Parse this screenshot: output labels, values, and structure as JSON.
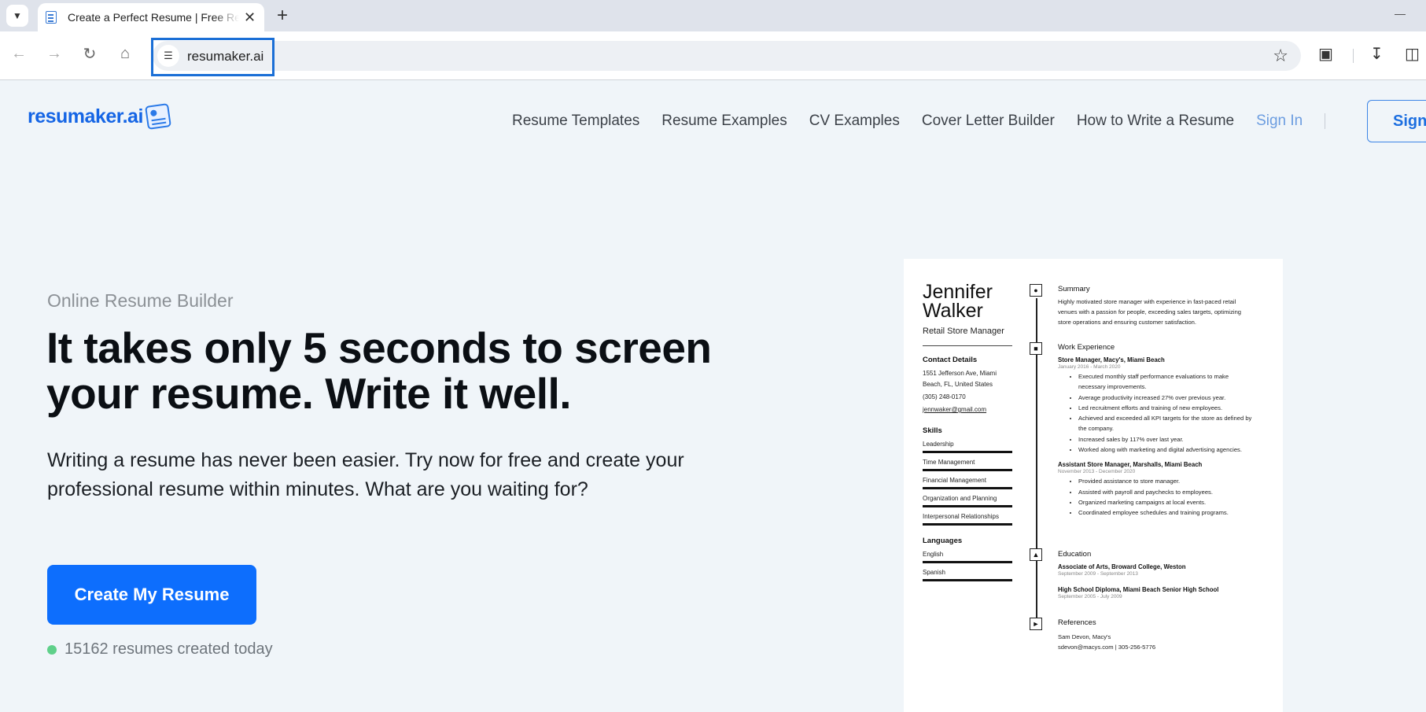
{
  "browser": {
    "tab_title": "Create a Perfect Resume | Free Resume Builder",
    "url": "resumaker.ai"
  },
  "site": {
    "logo": "resumaker.ai",
    "nav": [
      "Resume Templates",
      "Resume Examples",
      "CV Examples",
      "Cover Letter Builder",
      "How to Write a Resume"
    ],
    "sign_in": "Sign In",
    "sign_up": "Sign"
  },
  "hero": {
    "eyebrow": "Online Resume Builder",
    "headline": "It takes only 5 seconds to screen your resume. Write it well.",
    "subtext": "Writing a resume has never been easier. Try now for free and create your professional resume within minutes. What are you waiting for?",
    "cta": "Create My Resume",
    "counter": "15162 resumes created today"
  },
  "resume": {
    "first_name": "Jennifer",
    "last_name": "Walker",
    "role": "Retail Store Manager",
    "contact_heading": "Contact Details",
    "address": "1551 Jefferson Ave, Miami Beach, FL, United States",
    "phone": "(305) 248-0170",
    "email": "jennwaker@gmail.com",
    "skills_heading": "Skills",
    "skills": [
      "Leadership",
      "Time Management",
      "Financial Management",
      "Organization and Planning",
      "Interpersonal Relationships"
    ],
    "languages_heading": "Languages",
    "languages": [
      "English",
      "Spanish"
    ],
    "summary_heading": "Summary",
    "summary": "Highly motivated store manager with experience in fast-paced retail venues with a passion for people, exceeding sales targets, optimizing store operations and ensuring customer satisfaction.",
    "work_heading": "Work Experience",
    "jobs": [
      {
        "title": "Store Manager, Macy's, Miami Beach",
        "dates": "January 2016 - March 2020",
        "bullets": [
          "Executed monthly staff performance evaluations to make necessary improvements.",
          "Average productivity increased 27% over previous year.",
          "Led recruitment efforts and training of new employees.",
          "Achieved and exceeded all KPI targets for the store as defined by the company.",
          "Increased sales by 117% over last year.",
          "Worked along with marketing and digital advertising agencies."
        ]
      },
      {
        "title": "Assistant Store Manager, Marshalls, Miami Beach",
        "dates": "November 2013 - December 2020",
        "bullets": [
          "Provided assistance to store manager.",
          "Assisted with payroll and paychecks to employees.",
          "Organized marketing campaigns at local events.",
          "Coordinated employee schedules and training programs."
        ]
      }
    ],
    "education_heading": "Education",
    "education": [
      {
        "title": "Associate of Arts, Broward College, Weston",
        "dates": "September 2009 - September 2013"
      },
      {
        "title": "High School Diploma, Miami Beach Senior High School",
        "dates": "September 2005 - July 2009"
      }
    ],
    "references_heading": "References",
    "reference_name": "Sam Devon, Macy's",
    "reference_contact": "sdevon@macys.com | 305-256-5776"
  }
}
